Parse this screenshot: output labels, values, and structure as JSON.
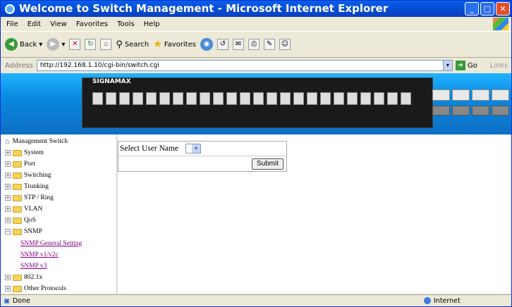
{
  "window": {
    "title": "Welcome to Switch Management - Microsoft Internet Explorer"
  },
  "menu": [
    "File",
    "Edit",
    "View",
    "Favorites",
    "Tools",
    "Help"
  ],
  "toolbar": {
    "back": "Back",
    "search": "Search",
    "favorites": "Favorites"
  },
  "address": {
    "label": "Address",
    "url": "http://192.168.1.10/cgi-bin/switch.cgi",
    "go": "Go",
    "links": "Links"
  },
  "banner": {
    "logo": "SIGNAMAX"
  },
  "tree": {
    "root": "Management Switch",
    "items": [
      "System",
      "Port",
      "Switching",
      "Trunking",
      "STP / Ring",
      "VLAN",
      "QoS",
      "SNMP"
    ],
    "snmp_children": [
      "SNMP General Setting",
      "SNMP v1/v2c",
      "SNMP v3"
    ],
    "after": [
      "802.1x",
      "Other Protocols"
    ]
  },
  "form": {
    "label": "Select User Name",
    "submit": "Submit"
  },
  "status": {
    "left": "Done",
    "right": "Internet"
  }
}
